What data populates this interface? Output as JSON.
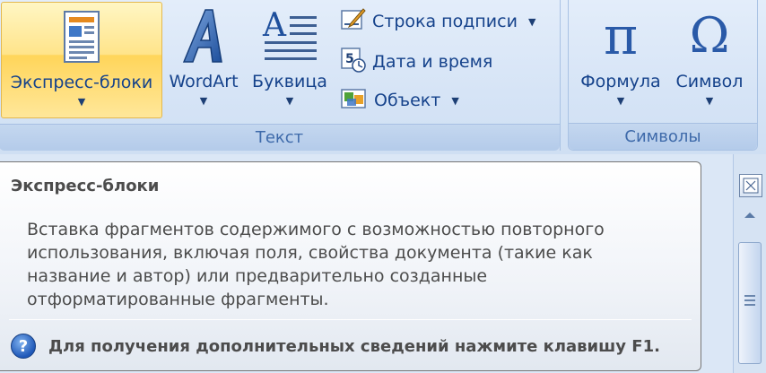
{
  "ribbon": {
    "text_group": {
      "label": "Текст",
      "quick_parts": {
        "label": "Экспресс-блоки",
        "icon": "quick-parts-icon"
      },
      "wordart": {
        "label": "WordArt",
        "icon": "wordart-icon"
      },
      "dropcap": {
        "label": "Буквица",
        "icon": "drop-cap-icon"
      },
      "signature_line": {
        "label": "Строка подписи",
        "icon": "signature-line-icon"
      },
      "date_time": {
        "label": "Дата и время",
        "icon": "date-time-icon"
      },
      "object": {
        "label": "Объект",
        "icon": "object-icon"
      }
    },
    "symbols_group": {
      "label": "Символы",
      "equation": {
        "label": "Формула",
        "glyph": "π",
        "icon": "pi-icon"
      },
      "symbol": {
        "label": "Символ",
        "glyph": "Ω",
        "icon": "omega-icon"
      }
    }
  },
  "tooltip": {
    "title": "Экспресс-блоки",
    "body": "Вставка фрагментов содержимого с возможностью повторного использования, включая поля, свойства документа (такие как название и автор) или предварительно созданные отформатированные фрагменты.",
    "help_text": "Для получения дополнительных сведений нажмите клавишу F1.",
    "help_glyph": "?"
  },
  "colors": {
    "ribbon_bg": "#d6e4f6",
    "label_text": "#15428b",
    "hover_gold": "#ffd55a",
    "tooltip_text": "#4c4c4c"
  }
}
